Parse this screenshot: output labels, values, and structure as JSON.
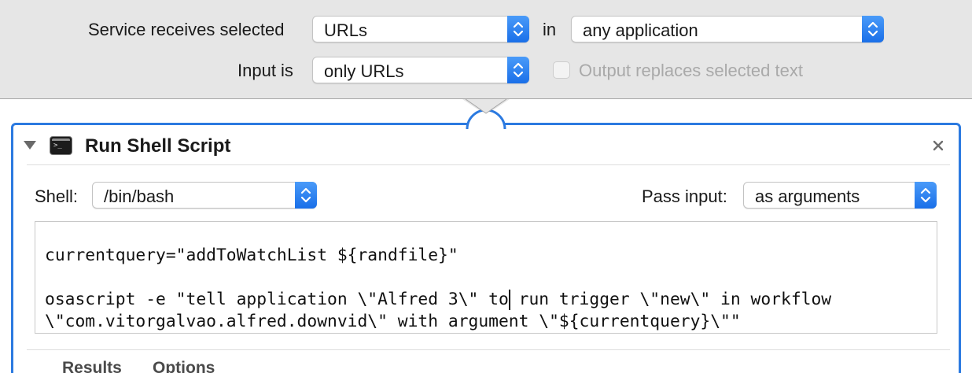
{
  "header": {
    "receives_label": "Service receives selected",
    "receives_value": "URLs",
    "in_label": "in",
    "application_value": "any application",
    "input_label": "Input is",
    "input_value": "only URLs",
    "output_replaces_label": "Output replaces selected text",
    "output_replaces_checked": false
  },
  "action": {
    "title": "Run Shell Script",
    "shell_label": "Shell:",
    "shell_value": "/bin/bash",
    "pass_input_label": "Pass input:",
    "pass_input_value": "as arguments",
    "script_lines": [
      "currentquery=\"addToWatchList ${randfile}\"",
      "osascript -e \"tell application \\\"Alfred 3\\\" to run trigger \\\"new\\\" in workflow",
      "\\\"com.vitorgalvao.alfred.downvid\\\" with argument \\\"${currentquery}\\\"\""
    ],
    "tabs": [
      "Results",
      "Options"
    ]
  },
  "colors": {
    "accent": "#2c7ae0",
    "stepper": "#1a6fe8",
    "top_bar": "#e6e6e6"
  },
  "icons": [
    "chevron-updown-icon",
    "disclosure-triangle-icon",
    "terminal-icon",
    "close-icon"
  ]
}
